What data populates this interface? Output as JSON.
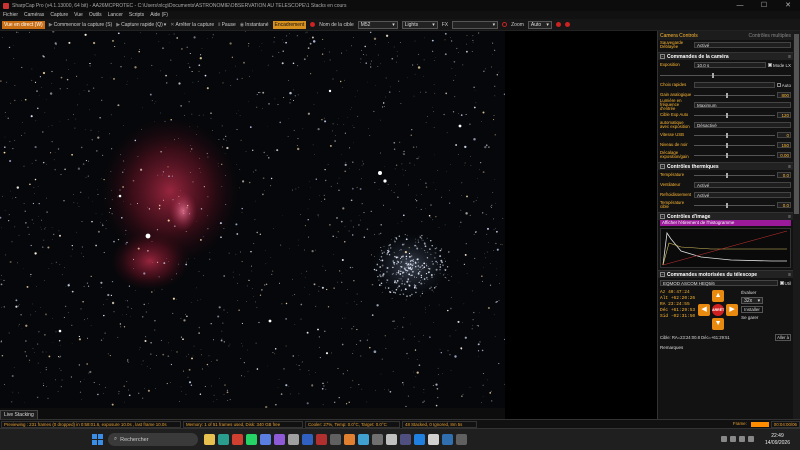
{
  "window": {
    "title": "SharpCap Pro (v4.1.13000, 64 bit) - AA26MCPROTEC - C:\\Users\\nlcg\\Documents\\ASTRONOMIE\\OBSERVATION AU TELESCOPE\\1 Stacks en cours",
    "minimize": "—",
    "maximize": "☐",
    "close": "✕"
  },
  "menu": [
    "Fichier",
    "Caméras",
    "Capture",
    "Vue",
    "Outils",
    "Lancer",
    "Scripts",
    "Aide (F)"
  ],
  "toolbar": {
    "live_view": "Vue en direct (W)",
    "start_capture": "Commencer la capture (S)",
    "quick_capture": "Capture rapide (Q)",
    "stop_capture": "Arrêter la capture",
    "pause": "Pause",
    "snapshot": "Instantané",
    "framing": "Encadrement",
    "target_label": "Nom de la cible",
    "target_value": "M52",
    "frame_type": "Lights",
    "fx_label": "FX",
    "fx_value": "",
    "zoom_label": "Zoom",
    "zoom_value": "Auto"
  },
  "panel": {
    "header_left": "Camera Controls",
    "header_right": "Contrôles multiples",
    "top_label": "Sauvegarde Déblayée",
    "top_value": "Activé",
    "camera_section": "Commandes de la caméra",
    "exposure_label": "Exposition",
    "exposure_value": "10.0 s",
    "lx_mode": "Mode LX",
    "quick_choices": "Choix rapides",
    "auto": "Auto",
    "gain_label": "Gain analogique",
    "gain_value": "800",
    "highgain_label": "Lumière en fréquence d'entrée",
    "highgain_value": "Maximum",
    "target_adu_label": "Cible Exp Auto",
    "target_adu_value": "120",
    "auto_exp_label": "automatique avec exposition",
    "auto_exp_value": "Désactivé",
    "usb_label": "Vitesse USB",
    "usb_value": "0",
    "black_label": "Niveau de noir",
    "black_value": "150",
    "offset_label": "Décalage exposition/gain",
    "offset_value": "0.00",
    "thermal_section": "Contrôles thermiques",
    "temp_label": "Température",
    "temp_value": "0.0",
    "fan_label": "Ventilateur",
    "fan_value": "Activé",
    "cooling_label": "Refroidissement",
    "cooling_value": "Activé",
    "target_temp_label": "Température cible",
    "target_temp_value": "0.0",
    "image_section": "Contrôles d'image",
    "histo_label": "Afficher l'étirement de l'histogramme",
    "scope_section": "Commandes motorisées du télescope",
    "mount_name": "EQMOD ASCOM HEQ5/6",
    "use_label": "Util",
    "az": "Az",
    "az_value": "40:47:24",
    "alt": "Alt",
    "alt_value": "+62:20:26",
    "ra": "RA",
    "ra_value": "23:24:55",
    "dec": "Déc",
    "dec_value": "+61:29:53",
    "sid": "Sid",
    "sid_value": "-02:31:50",
    "slew_label": "Évaluer",
    "slew_value": "32x",
    "install": "Installer",
    "on_park": "Se garer",
    "stop": "ARRÊT",
    "target_coords": "Cible:  RA=23:24:00.8 Déc=+61:29:51",
    "go_to": "Aller à",
    "remarks": "Remarques"
  },
  "live_tab": "Live Stacking",
  "status": {
    "frames": "Previewing : 231 frames (0 dropped) in 0:58:01.6, exposure 10.0s , last frame 10.0s",
    "memory": "Memory: 1 of 51 frames used, Disk: 340 GB free",
    "cooler": "Cooler: 27%, Temp: 0.0°C, Target: 0.0°C",
    "stacked": "48 Stacked, 0 Ignored, 8m 5s",
    "framing_label": "Frame:",
    "timer": "00:04:00/06"
  },
  "taskbar": {
    "search": "Rechercher",
    "time": "22:49",
    "date": "14/09/2026"
  },
  "colors": {
    "accent": "#ffb833",
    "active_button": "#c86f16",
    "histogram_bar": "#9a1a9a",
    "stop_button": "#d02020"
  }
}
